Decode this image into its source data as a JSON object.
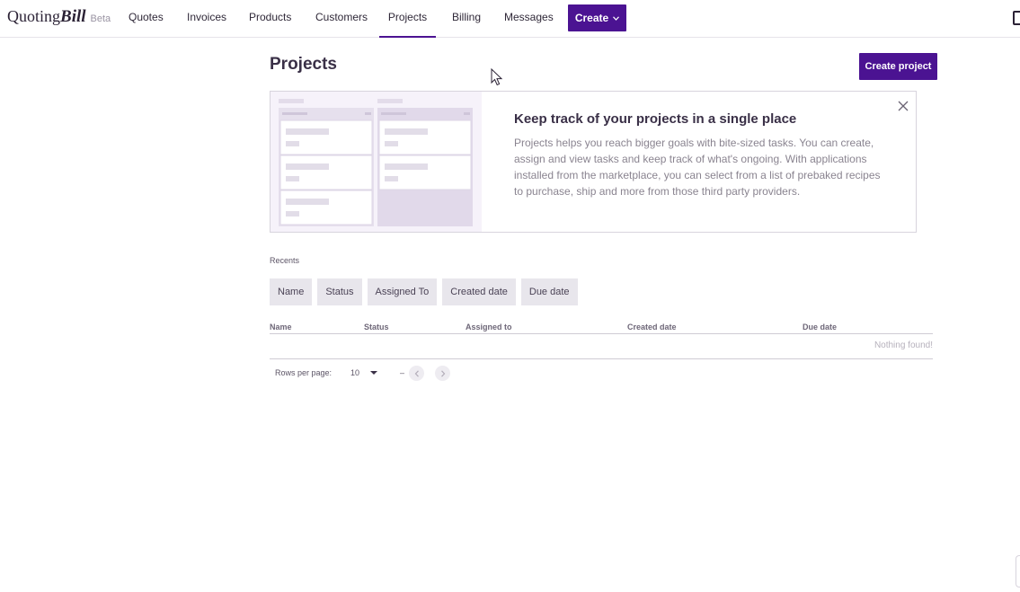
{
  "brand": {
    "name_part1": "Quoting",
    "name_part2": "Bill",
    "badge": "Beta"
  },
  "nav": {
    "items": [
      {
        "label": "Quotes"
      },
      {
        "label": "Invoices"
      },
      {
        "label": "Products"
      },
      {
        "label": "Customers"
      },
      {
        "label": "Projects",
        "active": true
      },
      {
        "label": "Billing"
      },
      {
        "label": "Messages"
      }
    ],
    "create_label": "Create"
  },
  "page": {
    "title": "Projects",
    "create_project_label": "Create project"
  },
  "banner": {
    "title": "Keep track of your projects in a single place",
    "text": "Projects helps you reach bigger goals with bite-sized tasks. You can create, assign and view tasks and keep track of what's ongoing. With applications installed from the marketplace, you can select from a list of prebaked recipes to purchase, ship and more from those third party providers."
  },
  "recents": {
    "label": "Recents",
    "filters": [
      "Name",
      "Status",
      "Assigned To",
      "Created date",
      "Due date"
    ]
  },
  "table": {
    "columns": [
      "Name",
      "Status",
      "Assigned to",
      "Created date",
      "Due date"
    ],
    "empty_text": "Nothing found!"
  },
  "pagination": {
    "rows_per_page_label": "Rows per page:",
    "rows_per_page": "10",
    "range": "–"
  },
  "colors": {
    "accent": "#4b1392",
    "chip_bg": "#e8e6ec",
    "illustration_bg": "#f6f2fa"
  }
}
